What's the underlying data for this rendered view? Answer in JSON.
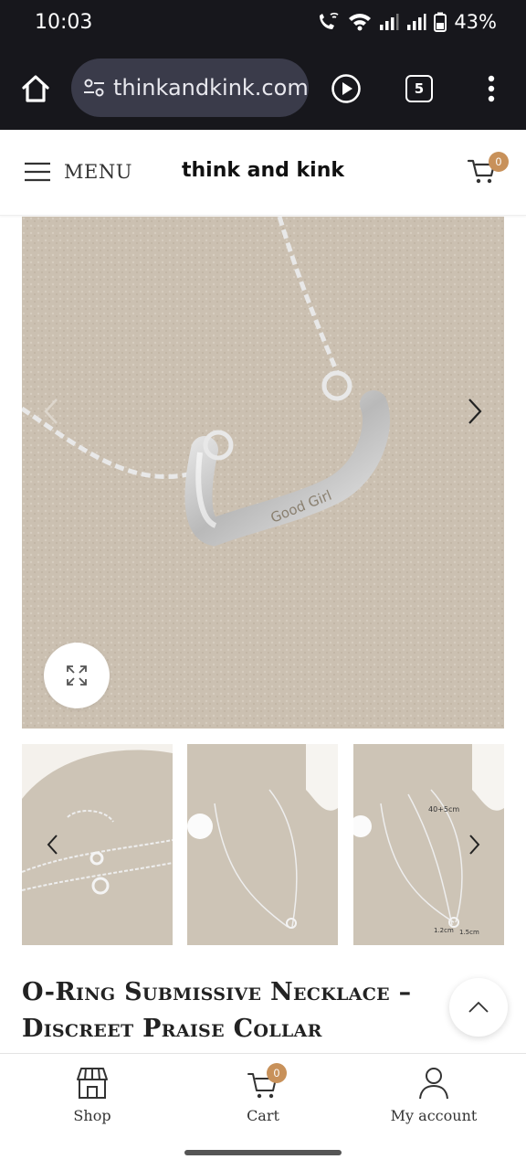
{
  "status_bar": {
    "time": "10:03",
    "battery": "43%",
    "icons": [
      "wifi-calling-icon",
      "wifi-icon",
      "signal-icon",
      "signal-icon",
      "battery-icon"
    ]
  },
  "browser": {
    "url": "thinkandkink.com",
    "tab_count": "5",
    "icons": [
      "home-icon",
      "site-settings-icon",
      "play-icon",
      "tab-switcher-icon",
      "more-vert-icon"
    ]
  },
  "header": {
    "menu_label": "MENU",
    "site_name": "think and kink",
    "cart_count": "0",
    "icons": [
      "hamburger-icon",
      "cart-icon"
    ]
  },
  "gallery": {
    "main_engraving": "Good Girl",
    "thumbnail_labels": [
      "40+5cm",
      "1.2cm",
      "1.5cm"
    ],
    "icons": [
      "chevron-left-icon",
      "chevron-right-icon",
      "expand-icon"
    ]
  },
  "product": {
    "title_line1": "O-Ring Submissive Necklace –",
    "title_line2": "Discreet Praise Collar"
  },
  "bottom_nav": {
    "shop_label": "Shop",
    "cart_label": "Cart",
    "cart_count": "0",
    "account_label": "My account",
    "icons": [
      "shop-icon",
      "cart-icon",
      "user-icon",
      "chevron-up-icon"
    ]
  },
  "colors": {
    "accent_badge": "#c8915a",
    "browser_bg": "#17171c",
    "url_pill": "#3a3b4a"
  }
}
